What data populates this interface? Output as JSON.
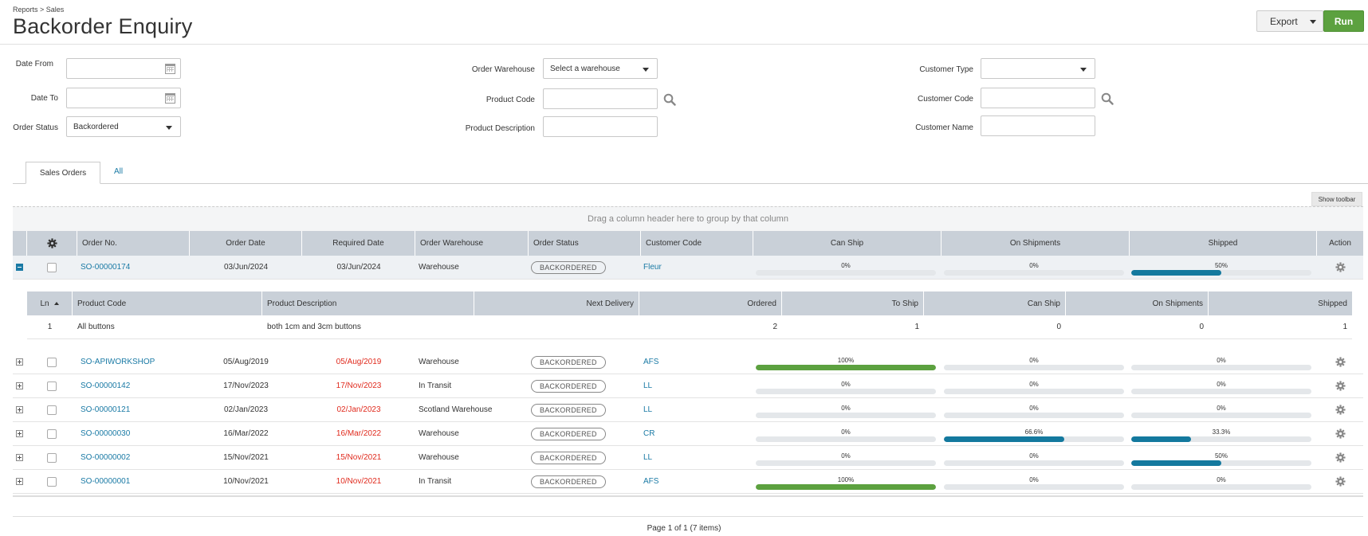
{
  "header": {
    "breadcrumb": "Reports > Sales",
    "title": "Backorder Enquiry",
    "export_label": "Export",
    "run_label": "Run"
  },
  "filters": {
    "date_from": {
      "label": "Date From",
      "value": ""
    },
    "date_to": {
      "label": "Date To",
      "value": ""
    },
    "order_status": {
      "label": "Order Status",
      "value": "Backordered"
    },
    "order_warehouse": {
      "label": "Order Warehouse",
      "value": "Select a warehouse"
    },
    "product_code": {
      "label": "Product Code",
      "value": ""
    },
    "product_description": {
      "label": "Product Description",
      "value": ""
    },
    "customer_type": {
      "label": "Customer Type",
      "value": ""
    },
    "customer_code": {
      "label": "Customer Code",
      "value": ""
    },
    "customer_name": {
      "label": "Customer Name",
      "value": ""
    }
  },
  "tabs": [
    {
      "label": "Sales Orders",
      "active": true
    },
    {
      "label": "All",
      "active": false
    }
  ],
  "grid": {
    "show_toolbar_label": "Show toolbar",
    "group_hint": "Drag a column header here to group by that column",
    "columns": [
      "Order No.",
      "Order Date",
      "Required Date",
      "Order Warehouse",
      "Order Status",
      "Customer Code",
      "Can Ship",
      "On Shipments",
      "Shipped",
      "Action"
    ],
    "rows": [
      {
        "order_no": "SO-00000174",
        "order_date": "03/Jun/2024",
        "required_date": "03/Jun/2024",
        "required_overdue": false,
        "warehouse": "Warehouse",
        "status": "BACKORDERED",
        "customer": "Fleur",
        "can_ship": "0%",
        "can_ship_value": 0,
        "on_shipments": "0%",
        "on_shipments_value": 0,
        "shipped": "50%",
        "shipped_value": 50,
        "expanded": true
      },
      {
        "order_no": "SO-APIWORKSHOP",
        "order_date": "05/Aug/2019",
        "required_date": "05/Aug/2019",
        "required_overdue": true,
        "warehouse": "Warehouse",
        "status": "BACKORDERED",
        "customer": "AFS",
        "can_ship": "100%",
        "can_ship_value": 100,
        "on_shipments": "0%",
        "on_shipments_value": 0,
        "shipped": "0%",
        "shipped_value": 0,
        "expanded": false
      },
      {
        "order_no": "SO-00000142",
        "order_date": "17/Nov/2023",
        "required_date": "17/Nov/2023",
        "required_overdue": true,
        "warehouse": "In Transit",
        "status": "BACKORDERED",
        "customer": "LL",
        "can_ship": "0%",
        "can_ship_value": 0,
        "on_shipments": "0%",
        "on_shipments_value": 0,
        "shipped": "0%",
        "shipped_value": 0,
        "expanded": false
      },
      {
        "order_no": "SO-00000121",
        "order_date": "02/Jan/2023",
        "required_date": "02/Jan/2023",
        "required_overdue": true,
        "warehouse": "Scotland Warehouse",
        "status": "BACKORDERED",
        "customer": "LL",
        "can_ship": "0%",
        "can_ship_value": 0,
        "on_shipments": "0%",
        "on_shipments_value": 0,
        "shipped": "0%",
        "shipped_value": 0,
        "expanded": false
      },
      {
        "order_no": "SO-00000030",
        "order_date": "16/Mar/2022",
        "required_date": "16/Mar/2022",
        "required_overdue": true,
        "warehouse": "Warehouse",
        "status": "BACKORDERED",
        "customer": "CR",
        "can_ship": "0%",
        "can_ship_value": 0,
        "on_shipments": "66.6%",
        "on_shipments_value": 66.6,
        "shipped": "33.3%",
        "shipped_value": 33.3,
        "expanded": false
      },
      {
        "order_no": "SO-00000002",
        "order_date": "15/Nov/2021",
        "required_date": "15/Nov/2021",
        "required_overdue": true,
        "warehouse": "Warehouse",
        "status": "BACKORDERED",
        "customer": "LL",
        "can_ship": "0%",
        "can_ship_value": 0,
        "on_shipments": "0%",
        "on_shipments_value": 0,
        "shipped": "50%",
        "shipped_value": 50,
        "expanded": false
      },
      {
        "order_no": "SO-00000001",
        "order_date": "10/Nov/2021",
        "required_date": "10/Nov/2021",
        "required_overdue": true,
        "warehouse": "In Transit",
        "status": "BACKORDERED",
        "customer": "AFS",
        "can_ship": "100%",
        "can_ship_value": 100,
        "on_shipments": "0%",
        "on_shipments_value": 0,
        "shipped": "0%",
        "shipped_value": 0,
        "expanded": false
      }
    ],
    "detail": {
      "columns": [
        "Ln",
        "Product Code",
        "Product Description",
        "Next Delivery",
        "Ordered",
        "To Ship",
        "Can Ship",
        "On Shipments",
        "Shipped"
      ],
      "rows": [
        {
          "ln": "1",
          "product_code": "All buttons",
          "product_description": "both 1cm and 3cm buttons",
          "next_delivery": "",
          "ordered": "2",
          "to_ship": "1",
          "can_ship": "0",
          "on_shipments": "0",
          "shipped": "1"
        }
      ]
    },
    "pager": "Page 1 of 1 (7 items)"
  },
  "colors": {
    "accent": "#1a7aa5",
    "run_green": "#5ca13f",
    "progress_green": "#5ca13f",
    "progress_blue": "#14799e",
    "overdue_red": "#e02a1d"
  },
  "icons": {
    "calendar": "calendar-icon",
    "search": "search-icon",
    "gear": "gear-icon",
    "dropdown": "chevron-down-icon"
  }
}
